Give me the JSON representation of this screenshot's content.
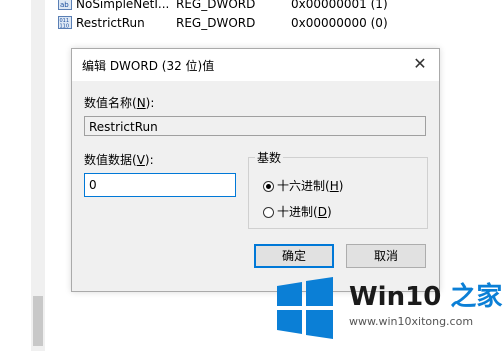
{
  "registry": {
    "rows": [
      {
        "name": "NoSimpleNetI...",
        "type": "REG_DWORD",
        "data": "0x00000001 (1)"
      },
      {
        "name": "RestrictRun",
        "type": "REG_DWORD",
        "data": "0x00000000 (0)"
      }
    ]
  },
  "dialog": {
    "title": "编辑 DWORD (32 位)值",
    "close_glyph": "✕",
    "value_name_label": "数值名称(",
    "value_name_key": "N",
    "value_name_label_end": "):",
    "value_name": "RestrictRun",
    "value_data_label": "数值数据(",
    "value_data_key": "V",
    "value_data_label_end": "):",
    "value_data": "0",
    "base_group": {
      "title": "基数",
      "options": [
        {
          "label": "十六进制(",
          "key": "H",
          "end": ")",
          "selected": true
        },
        {
          "label": "十进制(",
          "key": "D",
          "end": ")",
          "selected": false
        }
      ]
    },
    "ok_label": "确定",
    "cancel_label": "取消"
  },
  "watermark": {
    "brand_main": "Win10",
    "brand_accent": " 之家",
    "url": "www.win10xitong.com",
    "accent_color": "#0b7fd6"
  }
}
